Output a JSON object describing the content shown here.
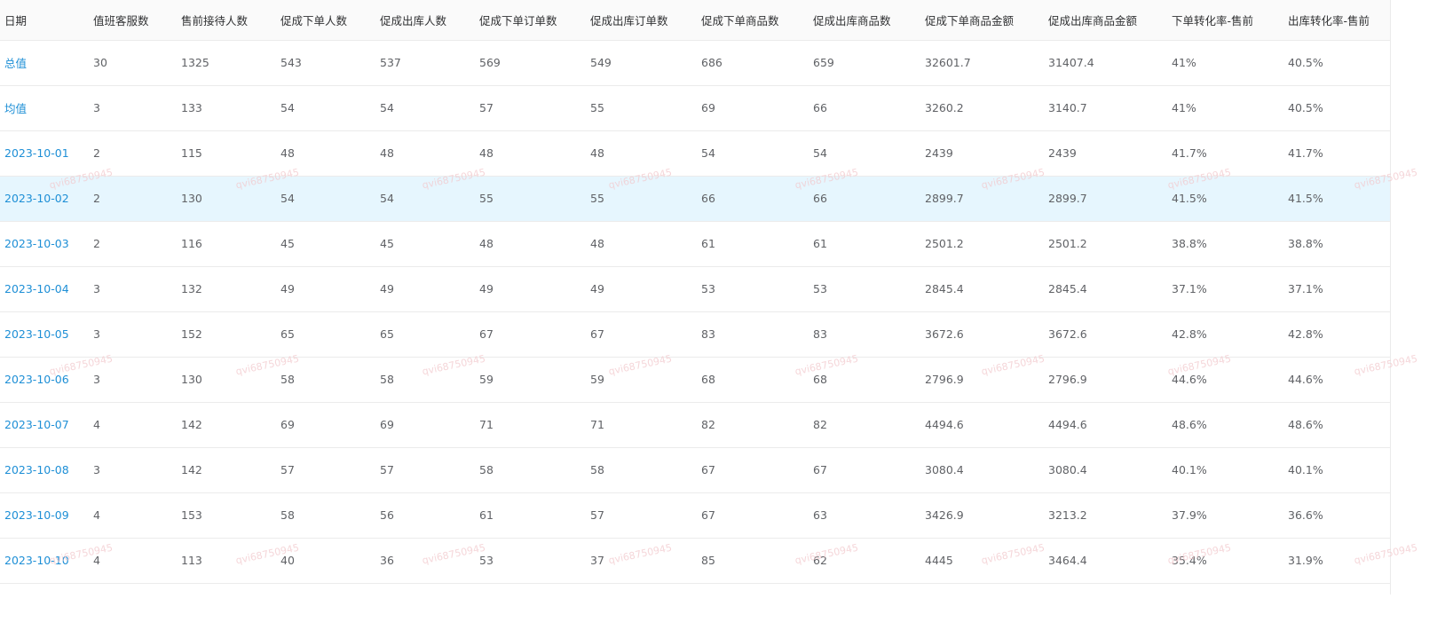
{
  "columns": [
    "日期",
    "值班客服数",
    "售前接待人数",
    "促成下单人数",
    "促成出库人数",
    "促成下单订单数",
    "促成出库订单数",
    "促成下单商品数",
    "促成出库商品数",
    "促成下单商品金额",
    "促成出库商品金额",
    "下单转化率-售前",
    "出库转化率-售前"
  ],
  "rows": [
    [
      "总值",
      "30",
      "1325",
      "543",
      "537",
      "569",
      "549",
      "686",
      "659",
      "32601.7",
      "31407.4",
      "41%",
      "40.5%"
    ],
    [
      "均值",
      "3",
      "133",
      "54",
      "54",
      "57",
      "55",
      "69",
      "66",
      "3260.2",
      "3140.7",
      "41%",
      "40.5%"
    ],
    [
      "2023-10-01",
      "2",
      "115",
      "48",
      "48",
      "48",
      "48",
      "54",
      "54",
      "2439",
      "2439",
      "41.7%",
      "41.7%"
    ],
    [
      "2023-10-02",
      "2",
      "130",
      "54",
      "54",
      "55",
      "55",
      "66",
      "66",
      "2899.7",
      "2899.7",
      "41.5%",
      "41.5%"
    ],
    [
      "2023-10-03",
      "2",
      "116",
      "45",
      "45",
      "48",
      "48",
      "61",
      "61",
      "2501.2",
      "2501.2",
      "38.8%",
      "38.8%"
    ],
    [
      "2023-10-04",
      "3",
      "132",
      "49",
      "49",
      "49",
      "49",
      "53",
      "53",
      "2845.4",
      "2845.4",
      "37.1%",
      "37.1%"
    ],
    [
      "2023-10-05",
      "3",
      "152",
      "65",
      "65",
      "67",
      "67",
      "83",
      "83",
      "3672.6",
      "3672.6",
      "42.8%",
      "42.8%"
    ],
    [
      "2023-10-06",
      "3",
      "130",
      "58",
      "58",
      "59",
      "59",
      "68",
      "68",
      "2796.9",
      "2796.9",
      "44.6%",
      "44.6%"
    ],
    [
      "2023-10-07",
      "4",
      "142",
      "69",
      "69",
      "71",
      "71",
      "82",
      "82",
      "4494.6",
      "4494.6",
      "48.6%",
      "48.6%"
    ],
    [
      "2023-10-08",
      "3",
      "142",
      "57",
      "57",
      "58",
      "58",
      "67",
      "67",
      "3080.4",
      "3080.4",
      "40.1%",
      "40.1%"
    ],
    [
      "2023-10-09",
      "4",
      "153",
      "58",
      "56",
      "61",
      "57",
      "67",
      "63",
      "3426.9",
      "3213.2",
      "37.9%",
      "36.6%"
    ],
    [
      "2023-10-10",
      "4",
      "113",
      "40",
      "36",
      "53",
      "37",
      "85",
      "62",
      "4445",
      "3464.4",
      "35.4%",
      "31.9%"
    ]
  ],
  "highlighted_row": 3,
  "watermark": "qvi68750945",
  "colors": {
    "link": "#1e8fd6",
    "highlight": "#e6f6fe",
    "header_bg": "#fafafa",
    "border": "#ebebeb",
    "text": "#606266",
    "watermark": "#f2c9cd"
  }
}
